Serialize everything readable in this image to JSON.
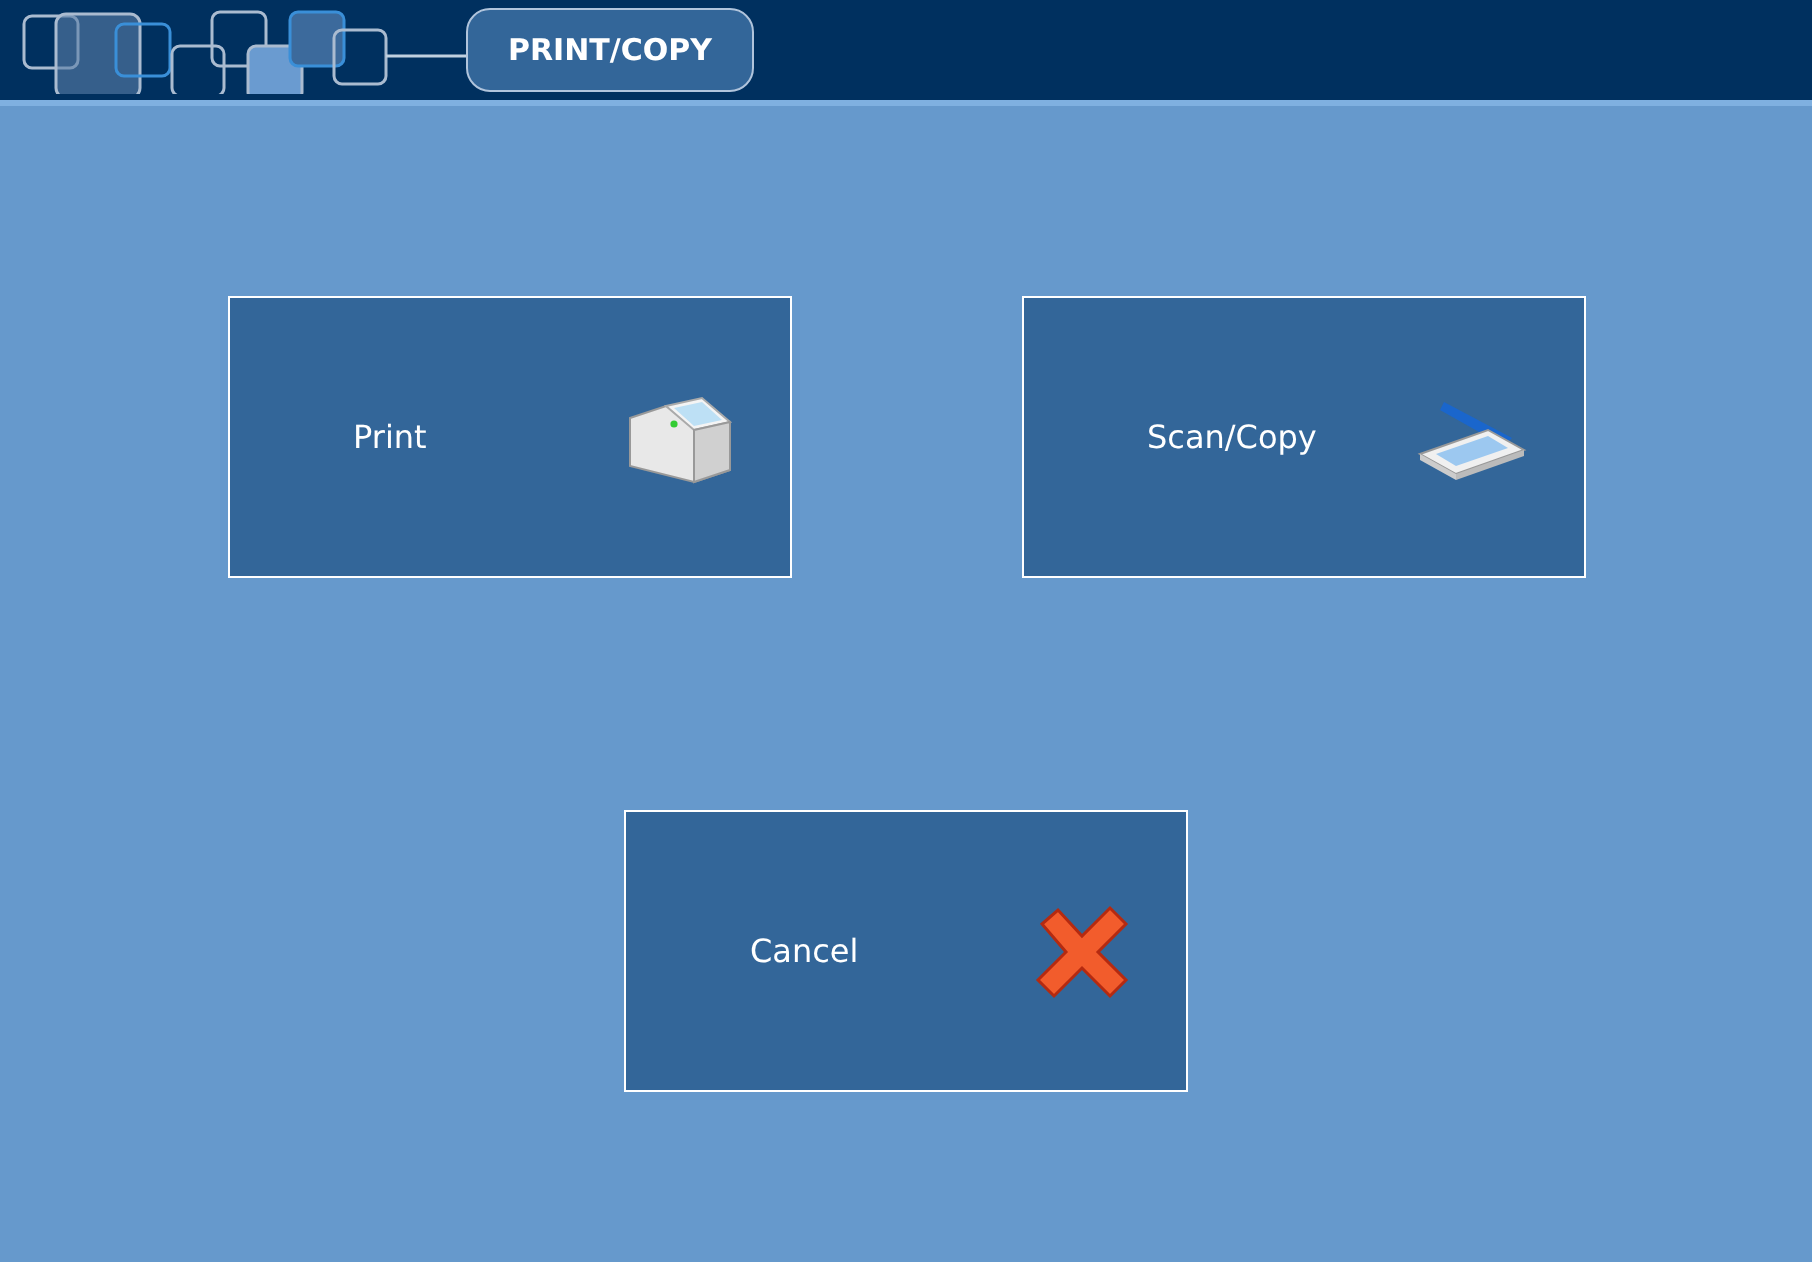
{
  "header": {
    "title": "PRINT/COPY"
  },
  "buttons": [
    {
      "label": "Print",
      "kind": "printer"
    },
    {
      "label": "Scan/Copy",
      "kind": "scanner"
    },
    {
      "label": "Cancel",
      "kind": "cancel"
    }
  ]
}
